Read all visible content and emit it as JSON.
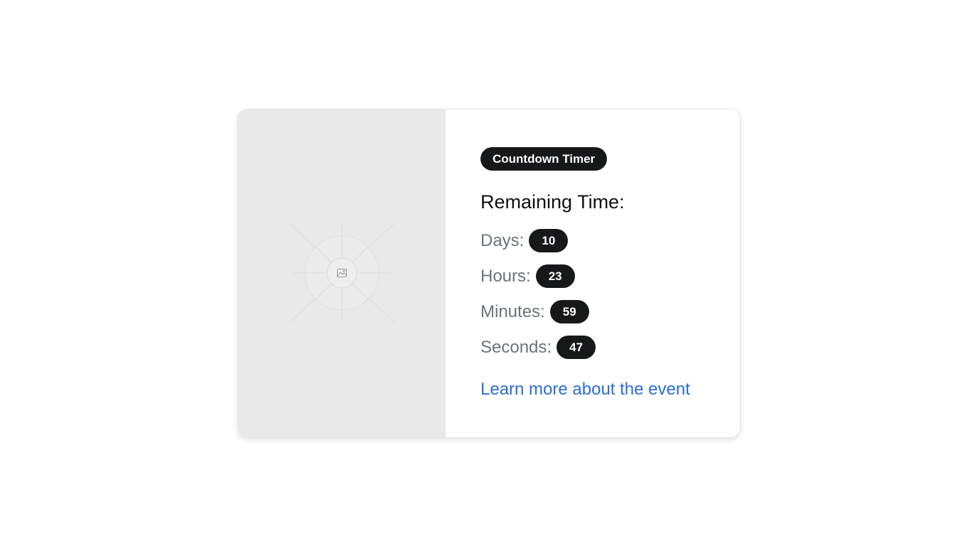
{
  "card": {
    "badge": "Countdown Timer",
    "heading": "Remaining Time:",
    "rows": [
      {
        "label": "Days:",
        "value": "10"
      },
      {
        "label": "Hours:",
        "value": "23"
      },
      {
        "label": "Minutes:",
        "value": "59"
      },
      {
        "label": "Seconds:",
        "value": "47"
      }
    ],
    "link": "Learn more about the event",
    "image_icon": "image-placeholder-icon"
  },
  "colors": {
    "pill_bg": "#17181a",
    "link": "#2b6cd4",
    "label": "#6b7280",
    "image_bg": "#e9e9e9"
  }
}
